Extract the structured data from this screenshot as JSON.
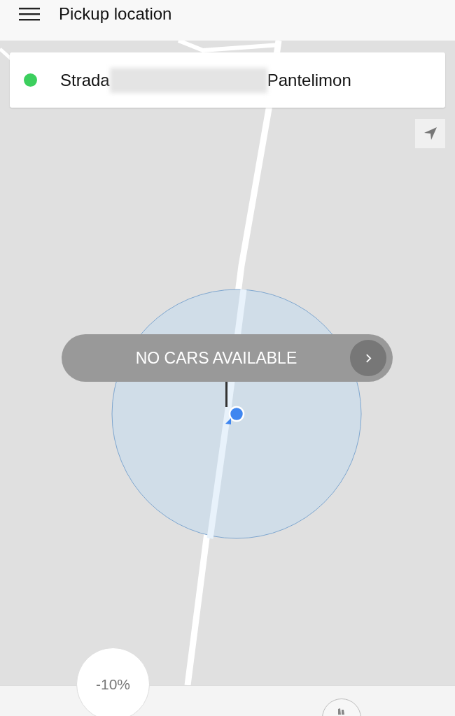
{
  "header": {
    "title": "Pickup location"
  },
  "pickup": {
    "address_start": "Strada",
    "address_redacted": true,
    "address_end": "Pantelimon"
  },
  "banner": {
    "label": "NO CARS AVAILABLE"
  },
  "discount": {
    "label": "-10%"
  }
}
